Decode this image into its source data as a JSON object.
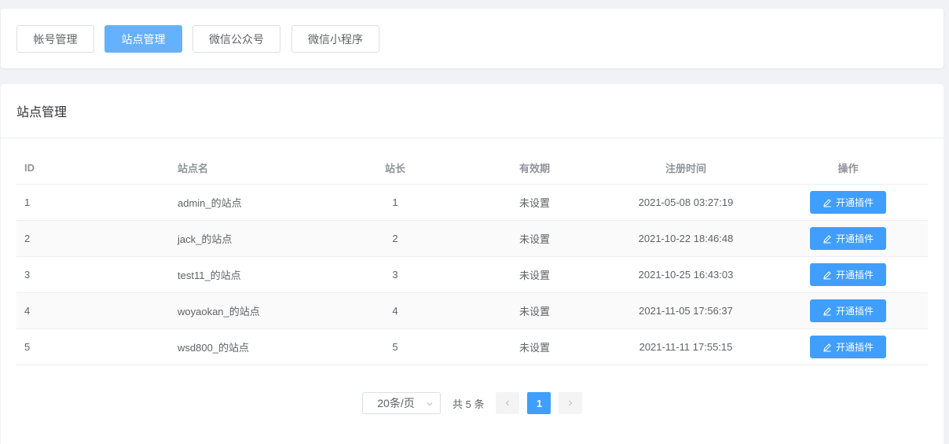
{
  "tabs": [
    {
      "label": "帐号管理",
      "active": false
    },
    {
      "label": "站点管理",
      "active": true
    },
    {
      "label": "微信公众号",
      "active": false
    },
    {
      "label": "微信小程序",
      "active": false
    }
  ],
  "card": {
    "title": "站点管理"
  },
  "table": {
    "headers": [
      "ID",
      "站点名",
      "站长",
      "有效期",
      "注册时间",
      "操作"
    ],
    "rows": [
      {
        "id": "1",
        "name": "admin_的站点",
        "owner": "1",
        "valid": "未设置",
        "time": "2021-05-08 03:27:19",
        "action": "开通插件"
      },
      {
        "id": "2",
        "name": "jack_的站点",
        "owner": "2",
        "valid": "未设置",
        "time": "2021-10-22 18:46:48",
        "action": "开通插件"
      },
      {
        "id": "3",
        "name": "test11_的站点",
        "owner": "3",
        "valid": "未设置",
        "time": "2021-10-25 16:43:03",
        "action": "开通插件"
      },
      {
        "id": "4",
        "name": "woyaokan_的站点",
        "owner": "4",
        "valid": "未设置",
        "time": "2021-11-05 17:56:37",
        "action": "开通插件"
      },
      {
        "id": "5",
        "name": "wsd800_的站点",
        "owner": "5",
        "valid": "未设置",
        "time": "2021-11-11 17:55:15",
        "action": "开通插件"
      }
    ]
  },
  "pagination": {
    "page_size": "20条/页",
    "total": "共 5 条",
    "current": "1"
  },
  "icons": {
    "edit": "edit-icon",
    "prev": "chevron-left-icon",
    "next": "chevron-right-icon",
    "dropdown": "chevron-down-icon"
  },
  "colors": {
    "primary": "#409eff",
    "active_tab": "#66b1ff"
  }
}
